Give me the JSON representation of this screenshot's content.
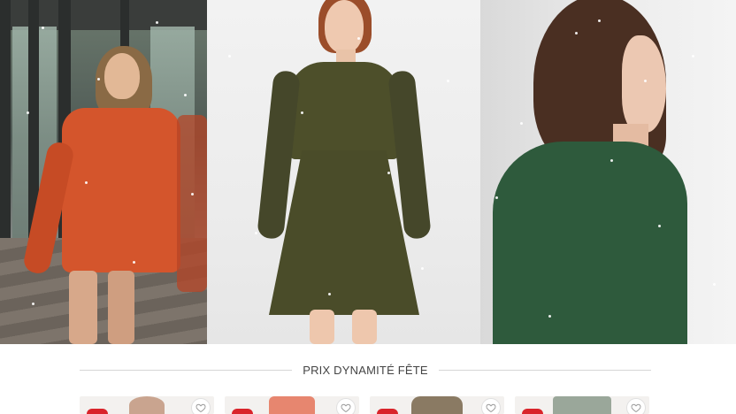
{
  "hero": {
    "panels": [
      {
        "name": "model-orange-dress",
        "dress_color": "#d4552c"
      },
      {
        "name": "model-olive-print-dress",
        "dress_color": "#4d4f2a"
      },
      {
        "name": "model-green-print-blouse",
        "dress_color": "#2e5a3c"
      }
    ]
  },
  "section": {
    "title": "PRIX DYNAMITÉ FÊTE"
  },
  "products": [
    {
      "thumb_color": "#c9a48f"
    },
    {
      "thumb_color": "#e7866f"
    },
    {
      "thumb_color": "#8a7a63"
    },
    {
      "thumb_color": "#9aa79a"
    }
  ],
  "colors": {
    "accent_badge": "#d9242b",
    "rule": "#d6d6d6",
    "title_text": "#444444"
  },
  "icons": {
    "favorite": "heart-icon"
  }
}
